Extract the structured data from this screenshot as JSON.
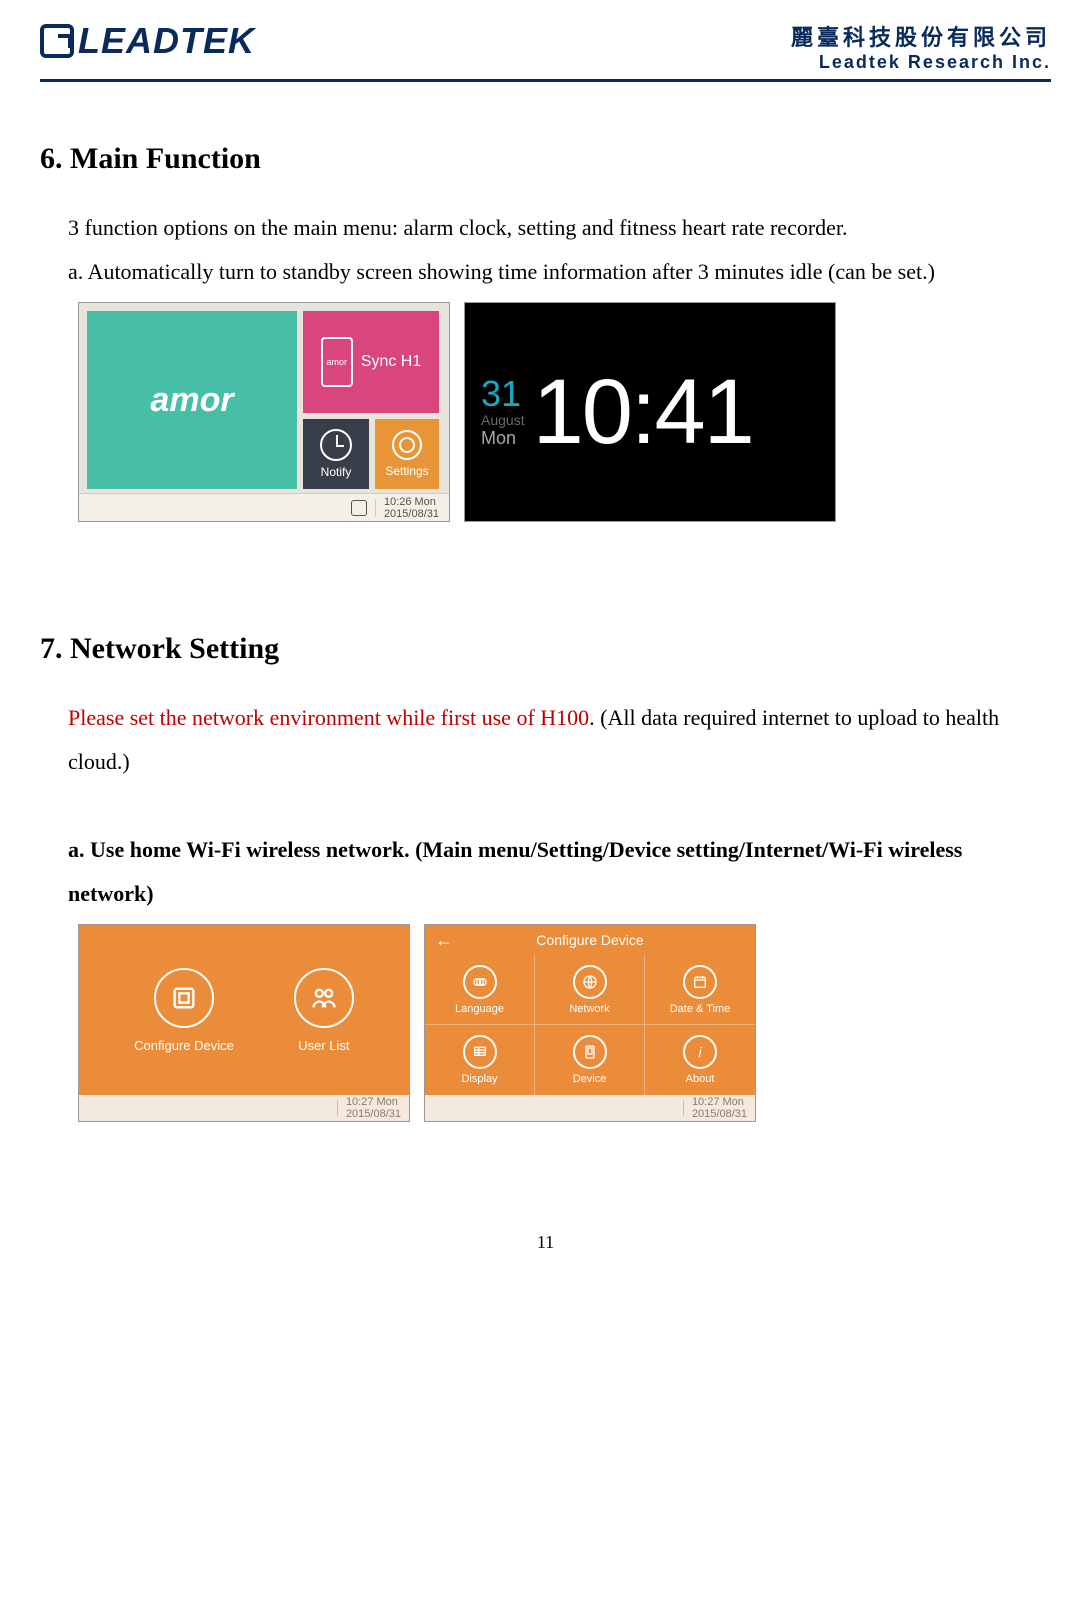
{
  "header": {
    "brand": "LEADTEK",
    "company_cn": "麗臺科技股份有限公司",
    "company_en": "Leadtek Research Inc."
  },
  "section6": {
    "heading": "6. Main Function",
    "intro": "3 function options on the main menu: alarm clock, setting and fitness heart rate recorder.",
    "item_a": "a.  Automatically turn to standby screen showing time information after 3 minutes idle (can be set.)"
  },
  "shot1": {
    "amor": "amor",
    "sync_phone": "amor",
    "sync": "Sync H1",
    "notify": "Notify",
    "settings": "Settings",
    "footer_time": "10:26 Mon",
    "footer_date": "2015/08/31"
  },
  "shot2": {
    "day": "31",
    "month": "August",
    "dow": "Mon",
    "time": "10:41"
  },
  "section7": {
    "heading": "7. Network Setting",
    "warn": "Please set the network environment while first use of H100",
    "warn_tail": ". (All data required internet to upload to health cloud.)",
    "item_a": "a.  Use home Wi-Fi wireless network.   (Main menu/Setting/Device setting/Internet/Wi-Fi wireless network)"
  },
  "shot3": {
    "configure": "Configure Device",
    "userlist": "User List",
    "footer_time": "10:27 Mon",
    "footer_date": "2015/08/31"
  },
  "shot4": {
    "back": "←",
    "title": "Configure Device",
    "cells": [
      "Language",
      "Network",
      "Date & Time",
      "Display",
      "Device",
      "About"
    ],
    "footer_time": "10:27 Mon",
    "footer_date": "2015/08/31"
  },
  "page_number": "11"
}
